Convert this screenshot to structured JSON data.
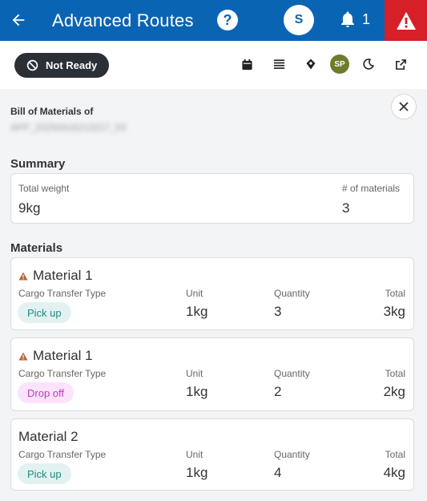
{
  "header": {
    "title": "Advanced Routes",
    "help_label": "?",
    "user_initial": "S",
    "notification_count": "1",
    "colors": {
      "bar": "#0a64b4",
      "alert": "#d61f26"
    }
  },
  "toolbar": {
    "status_label": "Not Ready",
    "sp_initials": "SP",
    "icons": [
      "calendar-icon",
      "list-icon",
      "map-pin-icon",
      "moon-icon",
      "external-link-icon"
    ]
  },
  "panel": {
    "bom_label": "Bill of Materials of",
    "bom_id": "APP_20250416213217_03",
    "summary_title": "Summary",
    "summary": {
      "weight_label": "Total weight",
      "weight_value": "9kg",
      "count_label": "# of materials",
      "count_value": "3"
    },
    "materials_title": "Materials",
    "materials": [
      {
        "name": "Material 1",
        "warning": true,
        "type_label": "Cargo Transfer Type",
        "type_value": "Pick up",
        "unit_label": "Unit",
        "unit_value": "1kg",
        "qty_label": "Quantity",
        "qty_value": "3",
        "total_label": "Total",
        "total_value": "3kg"
      },
      {
        "name": "Material 1",
        "warning": true,
        "type_label": "Cargo Transfer Type",
        "type_value": "Drop off",
        "unit_label": "Unit",
        "unit_value": "1kg",
        "qty_label": "Quantity",
        "qty_value": "2",
        "total_label": "Total",
        "total_value": "2kg"
      },
      {
        "name": "Material 2",
        "warning": false,
        "type_label": "Cargo Transfer Type",
        "type_value": "Pick up",
        "unit_label": "Unit",
        "unit_value": "1kg",
        "qty_label": "Quantity",
        "qty_value": "4",
        "total_label": "Total",
        "total_value": "4kg"
      }
    ]
  }
}
